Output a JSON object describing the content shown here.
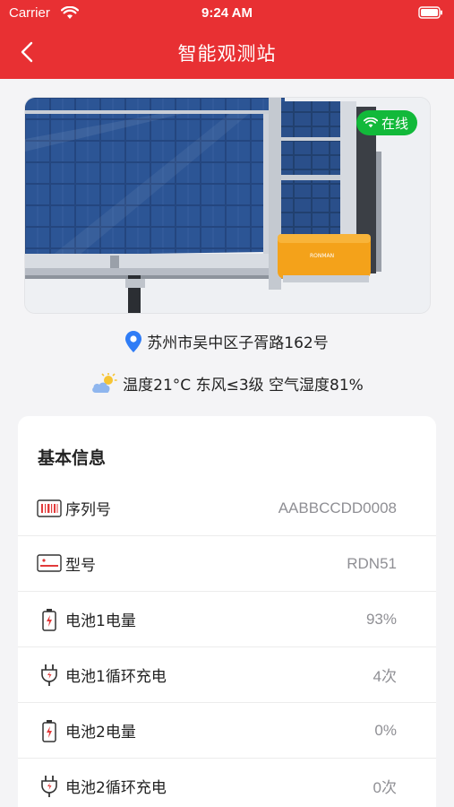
{
  "status_bar": {
    "carrier": "Carrier",
    "time": "9:24 AM"
  },
  "nav": {
    "title": "智能观测站"
  },
  "device": {
    "online_label": "在线",
    "brand_text": "RONMAN"
  },
  "location": {
    "address": "苏州市吴中区子胥路162号"
  },
  "weather": {
    "summary": "温度21°C 东风≤3级 空气湿度81%"
  },
  "basic_info": {
    "title": "基本信息",
    "rows": [
      {
        "icon": "barcode-icon",
        "label": "序列号",
        "value": "AABBCCDD0008"
      },
      {
        "icon": "model-card-icon",
        "label": "型号",
        "value": "RDN51"
      },
      {
        "icon": "battery-level-icon",
        "label": "电池1电量",
        "value": "93%"
      },
      {
        "icon": "charge-plug-icon",
        "label": "电池1循环充电",
        "value": "4次"
      },
      {
        "icon": "battery-level-icon",
        "label": "电池2电量",
        "value": "0%"
      },
      {
        "icon": "charge-plug-icon",
        "label": "电池2循环充电",
        "value": "0次"
      }
    ]
  },
  "colors": {
    "header_red": "#e83033",
    "online_green": "#12b93a",
    "location_blue": "#2f7cf6",
    "icon_red": "#e23a3a"
  }
}
